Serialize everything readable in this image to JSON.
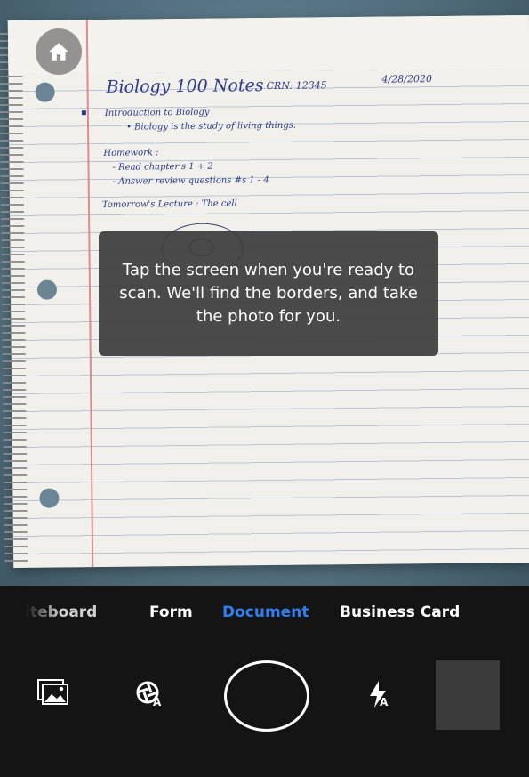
{
  "viewfinder": {
    "notes": {
      "title": "Biology 100 Notes",
      "crn": "CRN: 12345",
      "date": "4/28/2020",
      "lines": [
        "Introduction to Biology",
        "• Biology is the study of living things.",
        "Homework :",
        "- Read chapter's 1 + 2",
        "- Answer review questions #s 1 - 4",
        "Tomorrow's Lecture : The cell"
      ]
    },
    "toast_message": "Tap the screen when you're ready to scan. We'll find the borders, and take the photo for you."
  },
  "modes": {
    "items": [
      "iteboard",
      "Form",
      "Document",
      "Business Card"
    ],
    "selected": "Document",
    "selected_color": "#2f7ff0"
  },
  "controls": {
    "gallery_icon": "image-gallery-icon",
    "auto_capture_icon": "auto-capture-icon",
    "auto_capture_badge": "A",
    "flash_icon": "flash-auto-icon",
    "flash_badge": "A",
    "shutter": "shutter-button",
    "thumbnail": "last-scan-thumbnail"
  },
  "home_icon": "home-icon"
}
